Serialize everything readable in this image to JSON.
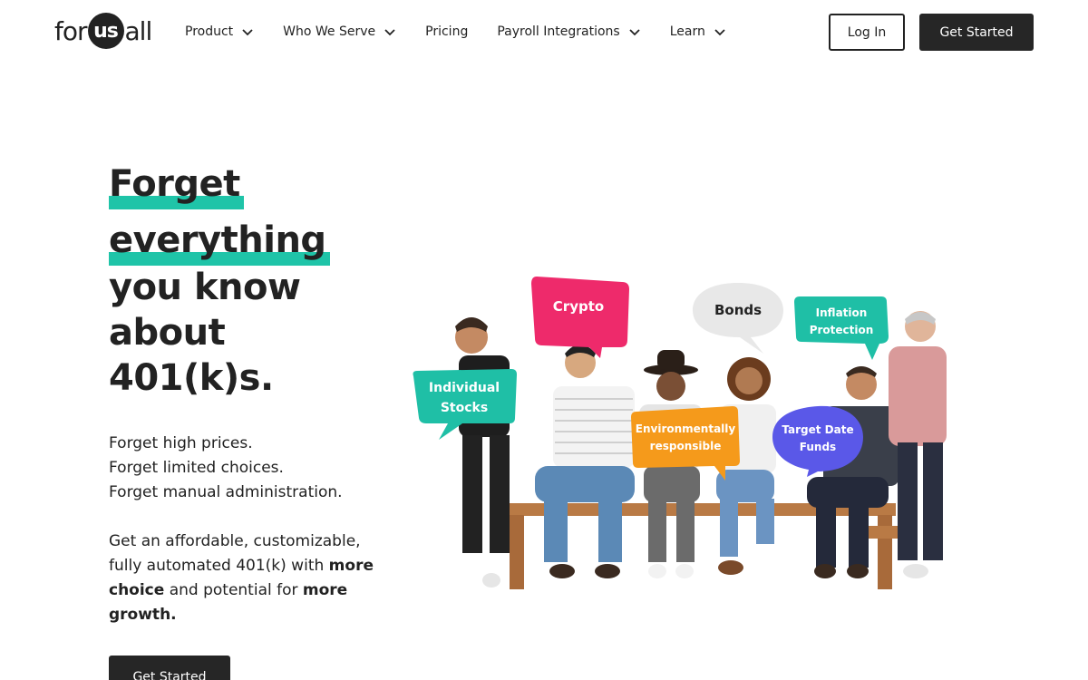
{
  "header": {
    "logo": {
      "pre": "for",
      "mid": "us",
      "post": "all"
    },
    "nav": [
      {
        "label": "Product",
        "has_dropdown": true,
        "icon": "chevron-down-icon"
      },
      {
        "label": "Who We Serve",
        "has_dropdown": true,
        "icon": "chevron-down-icon"
      },
      {
        "label": "Pricing",
        "has_dropdown": false
      },
      {
        "label": "Payroll Integrations",
        "has_dropdown": true,
        "icon": "chevron-down-icon"
      },
      {
        "label": "Learn",
        "has_dropdown": true,
        "icon": "chevron-down-icon"
      }
    ],
    "login_label": "Log In",
    "get_started_label": "Get Started"
  },
  "hero": {
    "title_lines": [
      "Forget",
      "everything",
      "you know",
      "about",
      "401(k)s."
    ],
    "forget_lines": [
      "Forget high prices.",
      "Forget limited choices.",
      "Forget manual administration."
    ],
    "desc": {
      "part1": "Get an affordable, customizable, fully automated 401(k) with ",
      "bold1": "more choice",
      "part2": " and potential for ",
      "bold2": "more growth."
    },
    "cta_label": "Get Started"
  },
  "illustration": {
    "bubbles": [
      {
        "label1": "Individual",
        "label2": "Stocks",
        "color": "#1fbfa6"
      },
      {
        "label1": "Crypto",
        "label2": "",
        "color": "#ee2a6b"
      },
      {
        "label1": "Bonds",
        "label2": "",
        "color": "#e6e6e6"
      },
      {
        "label1": "Inflation",
        "label2": "Protection",
        "color": "#1fbfa6"
      },
      {
        "label1": "Environmentally",
        "label2": "responsible",
        "color": "#f59a1b"
      },
      {
        "label1": "Target Date",
        "label2": "Funds",
        "color": "#5a58e8"
      }
    ]
  },
  "colors": {
    "accent_teal": "#1fc4a8",
    "dark_button": "#262626",
    "text": "#222222"
  }
}
